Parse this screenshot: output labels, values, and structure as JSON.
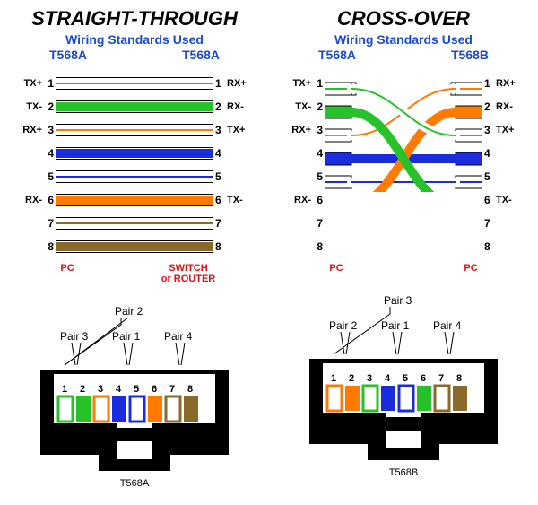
{
  "left": {
    "title": "STRAIGHT-THROUGH",
    "subtitle": "Wiring Standards Used",
    "std_left": "T568A",
    "std_right": "T568A",
    "device_left": "PC",
    "device_right": "SWITCH\nor ROUTER",
    "jack_label": "T568A",
    "pair_top": "Pair 2",
    "pair_left": "Pair 3",
    "pair_mid": "Pair 1",
    "pair_right": "Pair 4"
  },
  "right": {
    "title": "CROSS-OVER",
    "subtitle": "Wiring Standards Used",
    "std_left": "T568A",
    "std_right": "T568B",
    "device_left": "PC",
    "device_right": "PC",
    "jack_label": "T568B",
    "pair_top": "Pair 3",
    "pair_left": "Pair 2",
    "pair_mid": "Pair 1",
    "pair_right": "Pair 4"
  },
  "pins": {
    "p1": "1",
    "p2": "2",
    "p3": "3",
    "p4": "4",
    "p5": "5",
    "p6": "6",
    "p7": "7",
    "p8": "8"
  },
  "sig": {
    "txp": "TX+",
    "txm": "TX-",
    "rxp": "RX+",
    "rxm": "RX-",
    "none": ""
  },
  "colors": {
    "green": "#27c22a",
    "orange": "#ff7a00",
    "blue": "#1a2be0",
    "brown": "#8a6a2a",
    "white": "#ffffff"
  },
  "chart_data": {
    "type": "table",
    "title": "Ethernet Wiring Pinouts – Straight-Through vs Cross-Over",
    "straight_through": {
      "left_standard": "T568A",
      "right_standard": "T568A",
      "pins": [
        {
          "pin": 1,
          "left_signal": "TX+",
          "color": "white/green",
          "right_pin": 1,
          "right_signal": "RX+"
        },
        {
          "pin": 2,
          "left_signal": "TX-",
          "color": "green",
          "right_pin": 2,
          "right_signal": "RX-"
        },
        {
          "pin": 3,
          "left_signal": "RX+",
          "color": "white/orange",
          "right_pin": 3,
          "right_signal": "TX+"
        },
        {
          "pin": 4,
          "left_signal": "",
          "color": "blue",
          "right_pin": 4,
          "right_signal": ""
        },
        {
          "pin": 5,
          "left_signal": "",
          "color": "white/blue",
          "right_pin": 5,
          "right_signal": ""
        },
        {
          "pin": 6,
          "left_signal": "RX-",
          "color": "orange",
          "right_pin": 6,
          "right_signal": "TX-"
        },
        {
          "pin": 7,
          "left_signal": "",
          "color": "white/brown",
          "right_pin": 7,
          "right_signal": ""
        },
        {
          "pin": 8,
          "left_signal": "",
          "color": "brown",
          "right_pin": 8,
          "right_signal": ""
        }
      ]
    },
    "cross_over": {
      "left_standard": "T568A",
      "right_standard": "T568B",
      "pins": [
        {
          "pin": 1,
          "left_signal": "TX+",
          "color": "white/green",
          "right_pin": 3,
          "right_signal": "TX+"
        },
        {
          "pin": 2,
          "left_signal": "TX-",
          "color": "green",
          "right_pin": 6,
          "right_signal": "TX-"
        },
        {
          "pin": 3,
          "left_signal": "RX+",
          "color": "white/orange",
          "right_pin": 1,
          "right_signal": "RX+"
        },
        {
          "pin": 4,
          "left_signal": "",
          "color": "blue",
          "right_pin": 4,
          "right_signal": ""
        },
        {
          "pin": 5,
          "left_signal": "",
          "color": "white/blue",
          "right_pin": 5,
          "right_signal": ""
        },
        {
          "pin": 6,
          "left_signal": "RX-",
          "color": "orange",
          "right_pin": 2,
          "right_signal": "RX-"
        },
        {
          "pin": 7,
          "left_signal": "",
          "color": "white/brown",
          "right_pin": 7,
          "right_signal": ""
        },
        {
          "pin": 8,
          "left_signal": "",
          "color": "brown",
          "right_pin": 8,
          "right_signal": ""
        }
      ]
    },
    "t568a_jack_pairs": {
      "pair1": [
        4,
        5
      ],
      "pair2": [
        1,
        2
      ],
      "pair3": [
        3,
        6
      ],
      "pair4": [
        7,
        8
      ]
    },
    "t568b_jack_pairs": {
      "pair1": [
        4,
        5
      ],
      "pair2": [
        3,
        6
      ],
      "pair3": [
        1,
        2
      ],
      "pair4": [
        7,
        8
      ]
    }
  }
}
